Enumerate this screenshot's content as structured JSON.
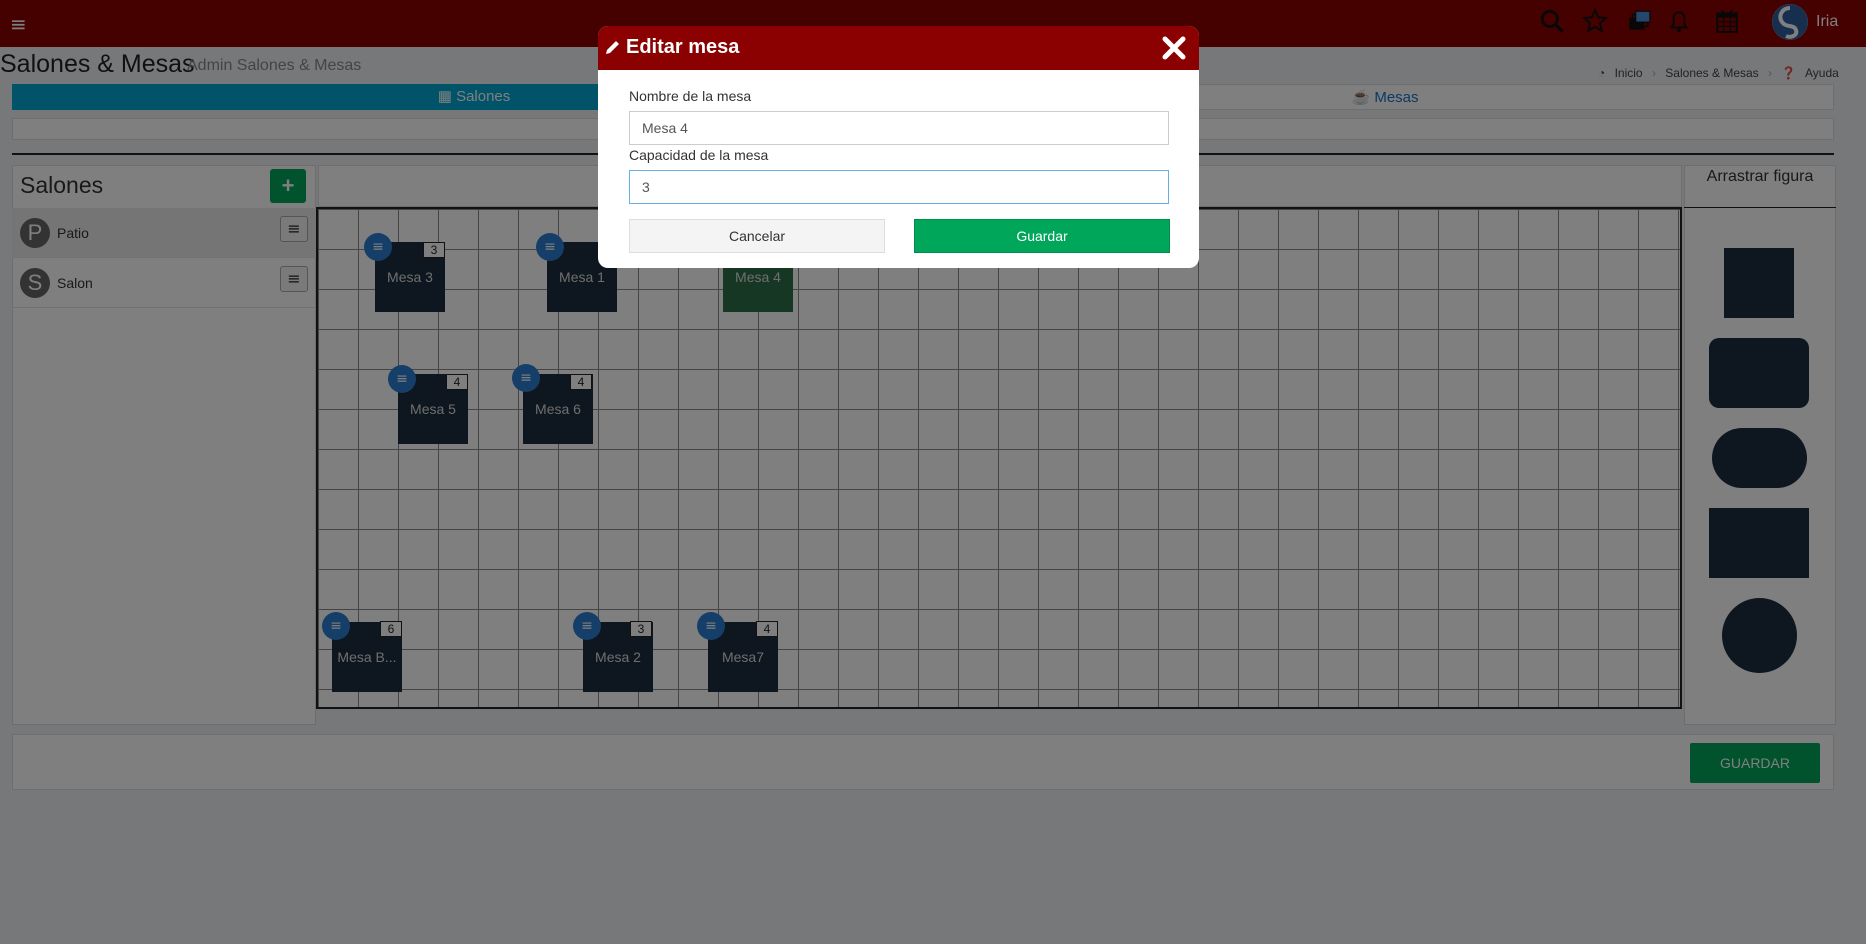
{
  "topbar": {
    "menu_glyph": "≡",
    "icons": [
      "search-icon",
      "star-icon",
      "layers-icon",
      "bell-icon",
      "calendar-icon"
    ],
    "username": "Iria",
    "color": "#8b0000"
  },
  "header": {
    "title": "Salones & Mesas",
    "subtitle": "Admin Salones & Mesas",
    "breadcrumb": [
      "Inicio",
      "Salones & Mesas"
    ],
    "help": "Ayuda"
  },
  "tabs": {
    "salones": "Salones",
    "mesas": "Mesas"
  },
  "sidebar": {
    "title": "Salones",
    "add_glyph": "+",
    "items": [
      {
        "letter": "P",
        "label": "Patio"
      },
      {
        "letter": "S",
        "label": "Salon"
      }
    ]
  },
  "tables": [
    {
      "name": "Mesa 3",
      "capacity": "3"
    },
    {
      "name": "Mesa 1",
      "capacity": ""
    },
    {
      "name": "Mesa 4",
      "capacity": ""
    },
    {
      "name": "Mesa 5",
      "capacity": "4"
    },
    {
      "name": "Mesa 6",
      "capacity": "4"
    },
    {
      "name": "Mesa B...",
      "capacity": "6"
    },
    {
      "name": "Mesa 2",
      "capacity": "3"
    },
    {
      "name": "Mesa7",
      "capacity": "4"
    }
  ],
  "shapes_panel": {
    "title": "Arrastrar figura"
  },
  "footer": {
    "save_label": "GUARDAR"
  },
  "modal": {
    "title": "Editar mesa",
    "name_label": "Nombre de la mesa",
    "name_value": "Mesa 4",
    "capacity_label": "Capacidad de la mesa",
    "capacity_value": "3",
    "cancel_label": "Cancelar",
    "save_label": "Guardar",
    "header_color": "#8b0000",
    "accent_color": "#00a65a"
  }
}
